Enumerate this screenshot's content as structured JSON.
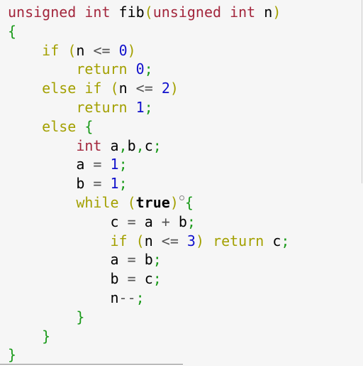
{
  "code": {
    "l1": {
      "t1": "unsigned",
      "t2": "int",
      "fn": "fib",
      "p_open": "(",
      "t3": "unsigned",
      "t4": "int",
      "arg": "n",
      "p_close": ")"
    },
    "l2": {
      "b": "{"
    },
    "l3": {
      "kw": "if",
      "po": "(",
      "a": "n",
      "op": "<=",
      "n": "0",
      "pc": ")"
    },
    "l4": {
      "kw": "return",
      "n": "0",
      "s": ";"
    },
    "l5": {
      "kw1": "else",
      "kw2": "if",
      "po": "(",
      "a": "n",
      "op": "<=",
      "n": "2",
      "pc": ")"
    },
    "l6": {
      "kw": "return",
      "n": "1",
      "s": ";"
    },
    "l7": {
      "kw": "else",
      "b": "{"
    },
    "l8": {
      "t": "int",
      "a": "a",
      "c1": ",",
      "b": "b",
      "c2": ",",
      "c": "c",
      "s": ";"
    },
    "l9": {
      "a": "a",
      "op": "=",
      "n": "1",
      "s": ";"
    },
    "l10": {
      "a": "b",
      "op": "=",
      "n": "1",
      "s": ";"
    },
    "l11": {
      "kw": "while",
      "po": "(",
      "v": "true",
      "pc": ")",
      "b": "{"
    },
    "l12": {
      "a": "c",
      "op1": "=",
      "x": "a",
      "op2": "+",
      "y": "b",
      "s": ";"
    },
    "l13": {
      "kw": "if",
      "po": "(",
      "a": "n",
      "op": "<=",
      "n": "3",
      "pc": ")",
      "kw2": "return",
      "r": "c",
      "s": ";"
    },
    "l14": {
      "a": "a",
      "op": "=",
      "b": "b",
      "s": ";"
    },
    "l15": {
      "a": "b",
      "op": "=",
      "b": "c",
      "s": ";"
    },
    "l16": {
      "a": "n",
      "op": "--",
      "s": ";"
    },
    "l17": {
      "b": "}"
    },
    "l18": {
      "b": "}"
    },
    "l19": {
      "b": "}"
    }
  },
  "colors": {
    "type_keyword": "#a3263c",
    "control_keyword": "#a3a000",
    "number": "#1010cc",
    "brace": "#1a9a1a",
    "background": "#f6f6f6"
  }
}
